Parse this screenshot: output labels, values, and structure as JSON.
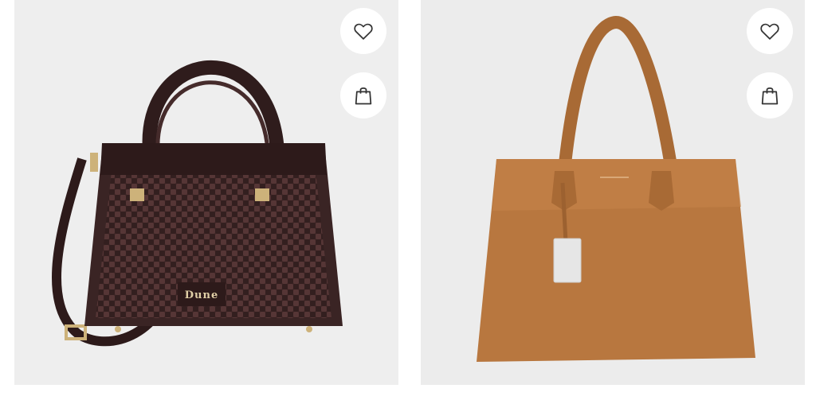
{
  "products": [
    {
      "brand_label": "Dune",
      "colors": {
        "body": "#3a2424",
        "weave": "#4a2e2e",
        "trim": "#2d1a1a",
        "hardware": "#cdb27a"
      },
      "actions": {
        "favorite_icon": "heart-icon",
        "bag_icon": "shopping-bag-icon"
      }
    },
    {
      "brand_label": "",
      "colors": {
        "body": "#b8773f",
        "handle": "#a86a35",
        "tag": "#e6e6e6"
      },
      "actions": {
        "favorite_icon": "heart-icon",
        "bag_icon": "shopping-bag-icon"
      }
    }
  ]
}
